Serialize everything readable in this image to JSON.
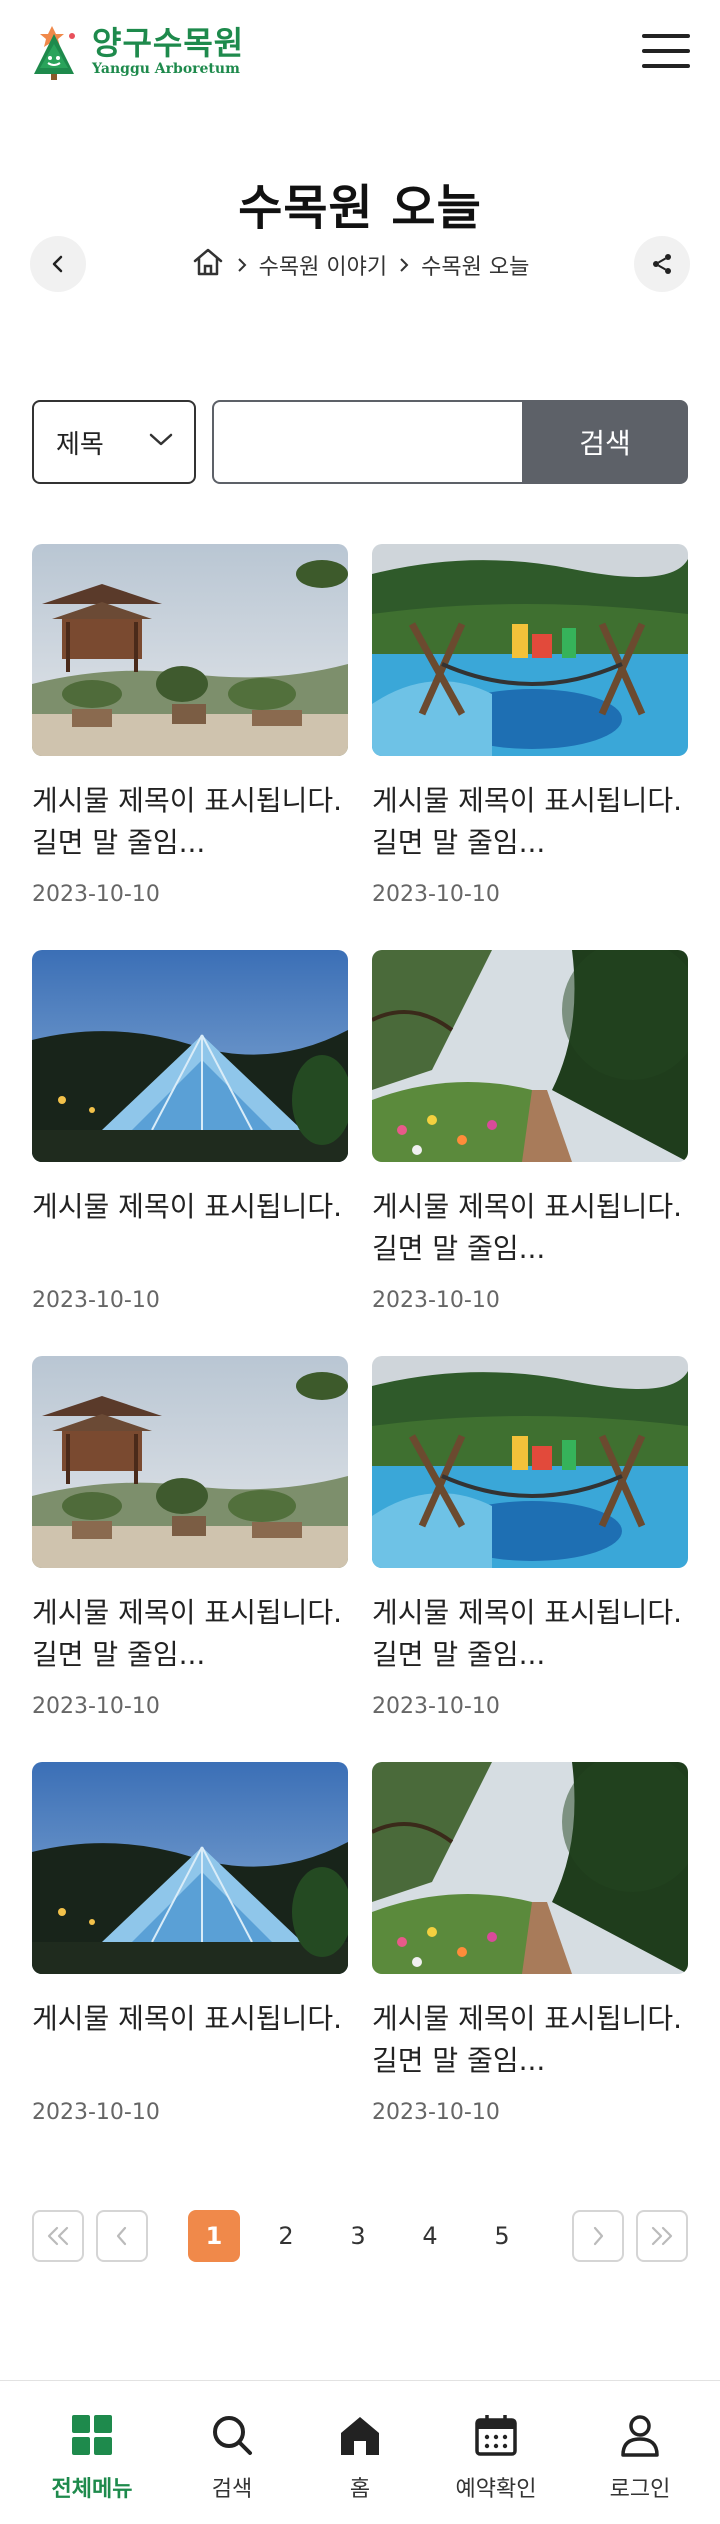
{
  "header": {
    "logo_ko": "양구수목원",
    "logo_en": "Yanggu Arboretum"
  },
  "page": {
    "title": "수목원 오늘"
  },
  "breadcrumb": {
    "items": [
      "수목원 이야기",
      "수목원 오늘"
    ]
  },
  "search": {
    "select_value": "제목",
    "input_value": "",
    "input_placeholder": "",
    "button_label": "검색"
  },
  "posts": [
    {
      "title_line1": "게시물 제목이 표시됩니다.",
      "title_line2": "길면 말 줄임...",
      "date": "2023-10-10",
      "image": "pavilion-photo"
    },
    {
      "title_line1": "게시물 제목이 표시됩니다.",
      "title_line2": "길면 말 줄임...",
      "date": "2023-10-10",
      "image": "playground-photo"
    },
    {
      "title_line1": "게시물 제목이 표시됩니다.",
      "title_line2": "",
      "date": "2023-10-10",
      "image": "greenhouse-photo"
    },
    {
      "title_line1": "게시물 제목이 표시됩니다.",
      "title_line2": "길면 말 줄임...",
      "date": "2023-10-10",
      "image": "forest-path-photo"
    },
    {
      "title_line1": "게시물 제목이 표시됩니다.",
      "title_line2": "길면 말 줄임...",
      "date": "2023-10-10",
      "image": "pavilion-photo"
    },
    {
      "title_line1": "게시물 제목이 표시됩니다.",
      "title_line2": "길면 말 줄임...",
      "date": "2023-10-10",
      "image": "playground-photo"
    },
    {
      "title_line1": "게시물 제목이 표시됩니다.",
      "title_line2": "",
      "date": "2023-10-10",
      "image": "greenhouse-photo"
    },
    {
      "title_line1": "게시물 제목이 표시됩니다.",
      "title_line2": "길면 말 줄임...",
      "date": "2023-10-10",
      "image": "forest-path-photo"
    }
  ],
  "pagination": {
    "pages": [
      "1",
      "2",
      "3",
      "4",
      "5"
    ],
    "current": "1"
  },
  "bottom_nav": [
    {
      "label": "전체메뉴",
      "icon": "grid-icon",
      "active": true
    },
    {
      "label": "검색",
      "icon": "search-icon",
      "active": false
    },
    {
      "label": "홈",
      "icon": "home-icon",
      "active": false
    },
    {
      "label": "예약확인",
      "icon": "calendar-icon",
      "active": false
    },
    {
      "label": "로그인",
      "icon": "user-icon",
      "active": false
    }
  ],
  "colors": {
    "brand_green": "#1e8a4c",
    "accent_orange": "#f0894a",
    "search_button": "#5d6168"
  }
}
